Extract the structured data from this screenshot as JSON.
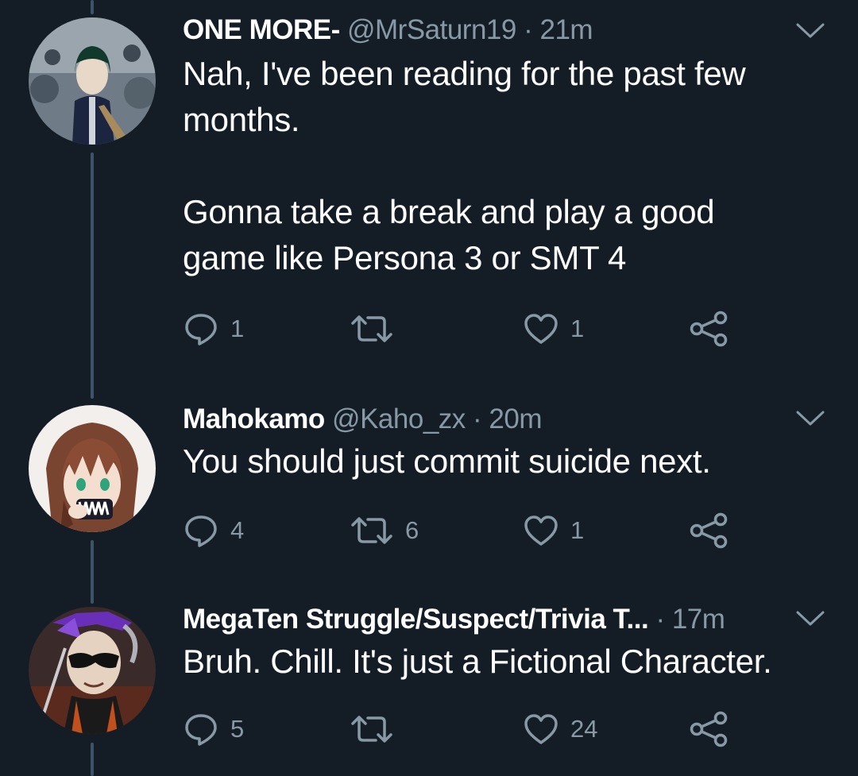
{
  "tweets": [
    {
      "name": "ONE MORE-",
      "handle": "@MrSaturn19",
      "separator": "·",
      "time": "21m",
      "text": "Nah, I've been reading for the past few\nmonths.\n\nGonna take a break and play a good\ngame like Persona 3 or SMT 4",
      "replies": "1",
      "retweets": "",
      "likes": "1"
    },
    {
      "name": "Mahokamo",
      "handle": "@Kaho_zx",
      "separator": "·",
      "time": "20m",
      "text": "You should just commit suicide next.",
      "replies": "4",
      "retweets": "6",
      "likes": "1"
    },
    {
      "name": "MegaTen Struggle/Suspect/Trivia T...",
      "handle": "",
      "separator": "·",
      "time": "17m",
      "text": "Bruh. Chill. It's just a Fictional Character.",
      "replies": "5",
      "retweets": "",
      "likes": "24"
    }
  ],
  "colors": {
    "background": "#141d26",
    "text_primary": "#ffffff",
    "text_secondary": "#8899a6",
    "thread_line": "#3d5466"
  }
}
